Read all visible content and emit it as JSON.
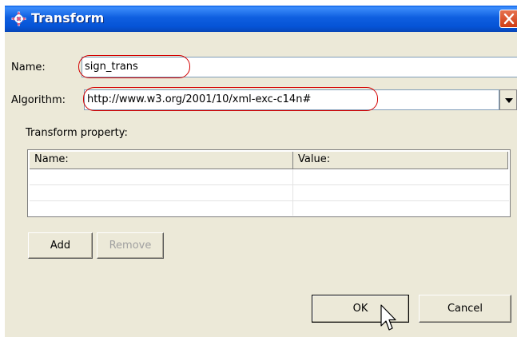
{
  "window": {
    "title": "Transform",
    "app_icon": "transform-cross-icon",
    "close_icon": "close-icon"
  },
  "form": {
    "name_label": "Name:",
    "name_value": "sign_trans",
    "algorithm_label": "Algorithm:",
    "algorithm_value": "http://www.w3.org/2001/10/xml-exc-c14n#",
    "property_label": "Transform property:"
  },
  "table": {
    "columns": [
      "Name:",
      "Value:"
    ],
    "rows": [
      [
        "",
        ""
      ],
      [
        "",
        ""
      ],
      [
        "",
        ""
      ]
    ]
  },
  "buttons": {
    "add": "Add",
    "remove": "Remove",
    "ok": "OK",
    "cancel": "Cancel"
  },
  "colors": {
    "titlebar": "#0553d6",
    "window_bg": "#ece9d8",
    "highlight_ring": "#d40000",
    "close_button": "#cf3b14"
  }
}
